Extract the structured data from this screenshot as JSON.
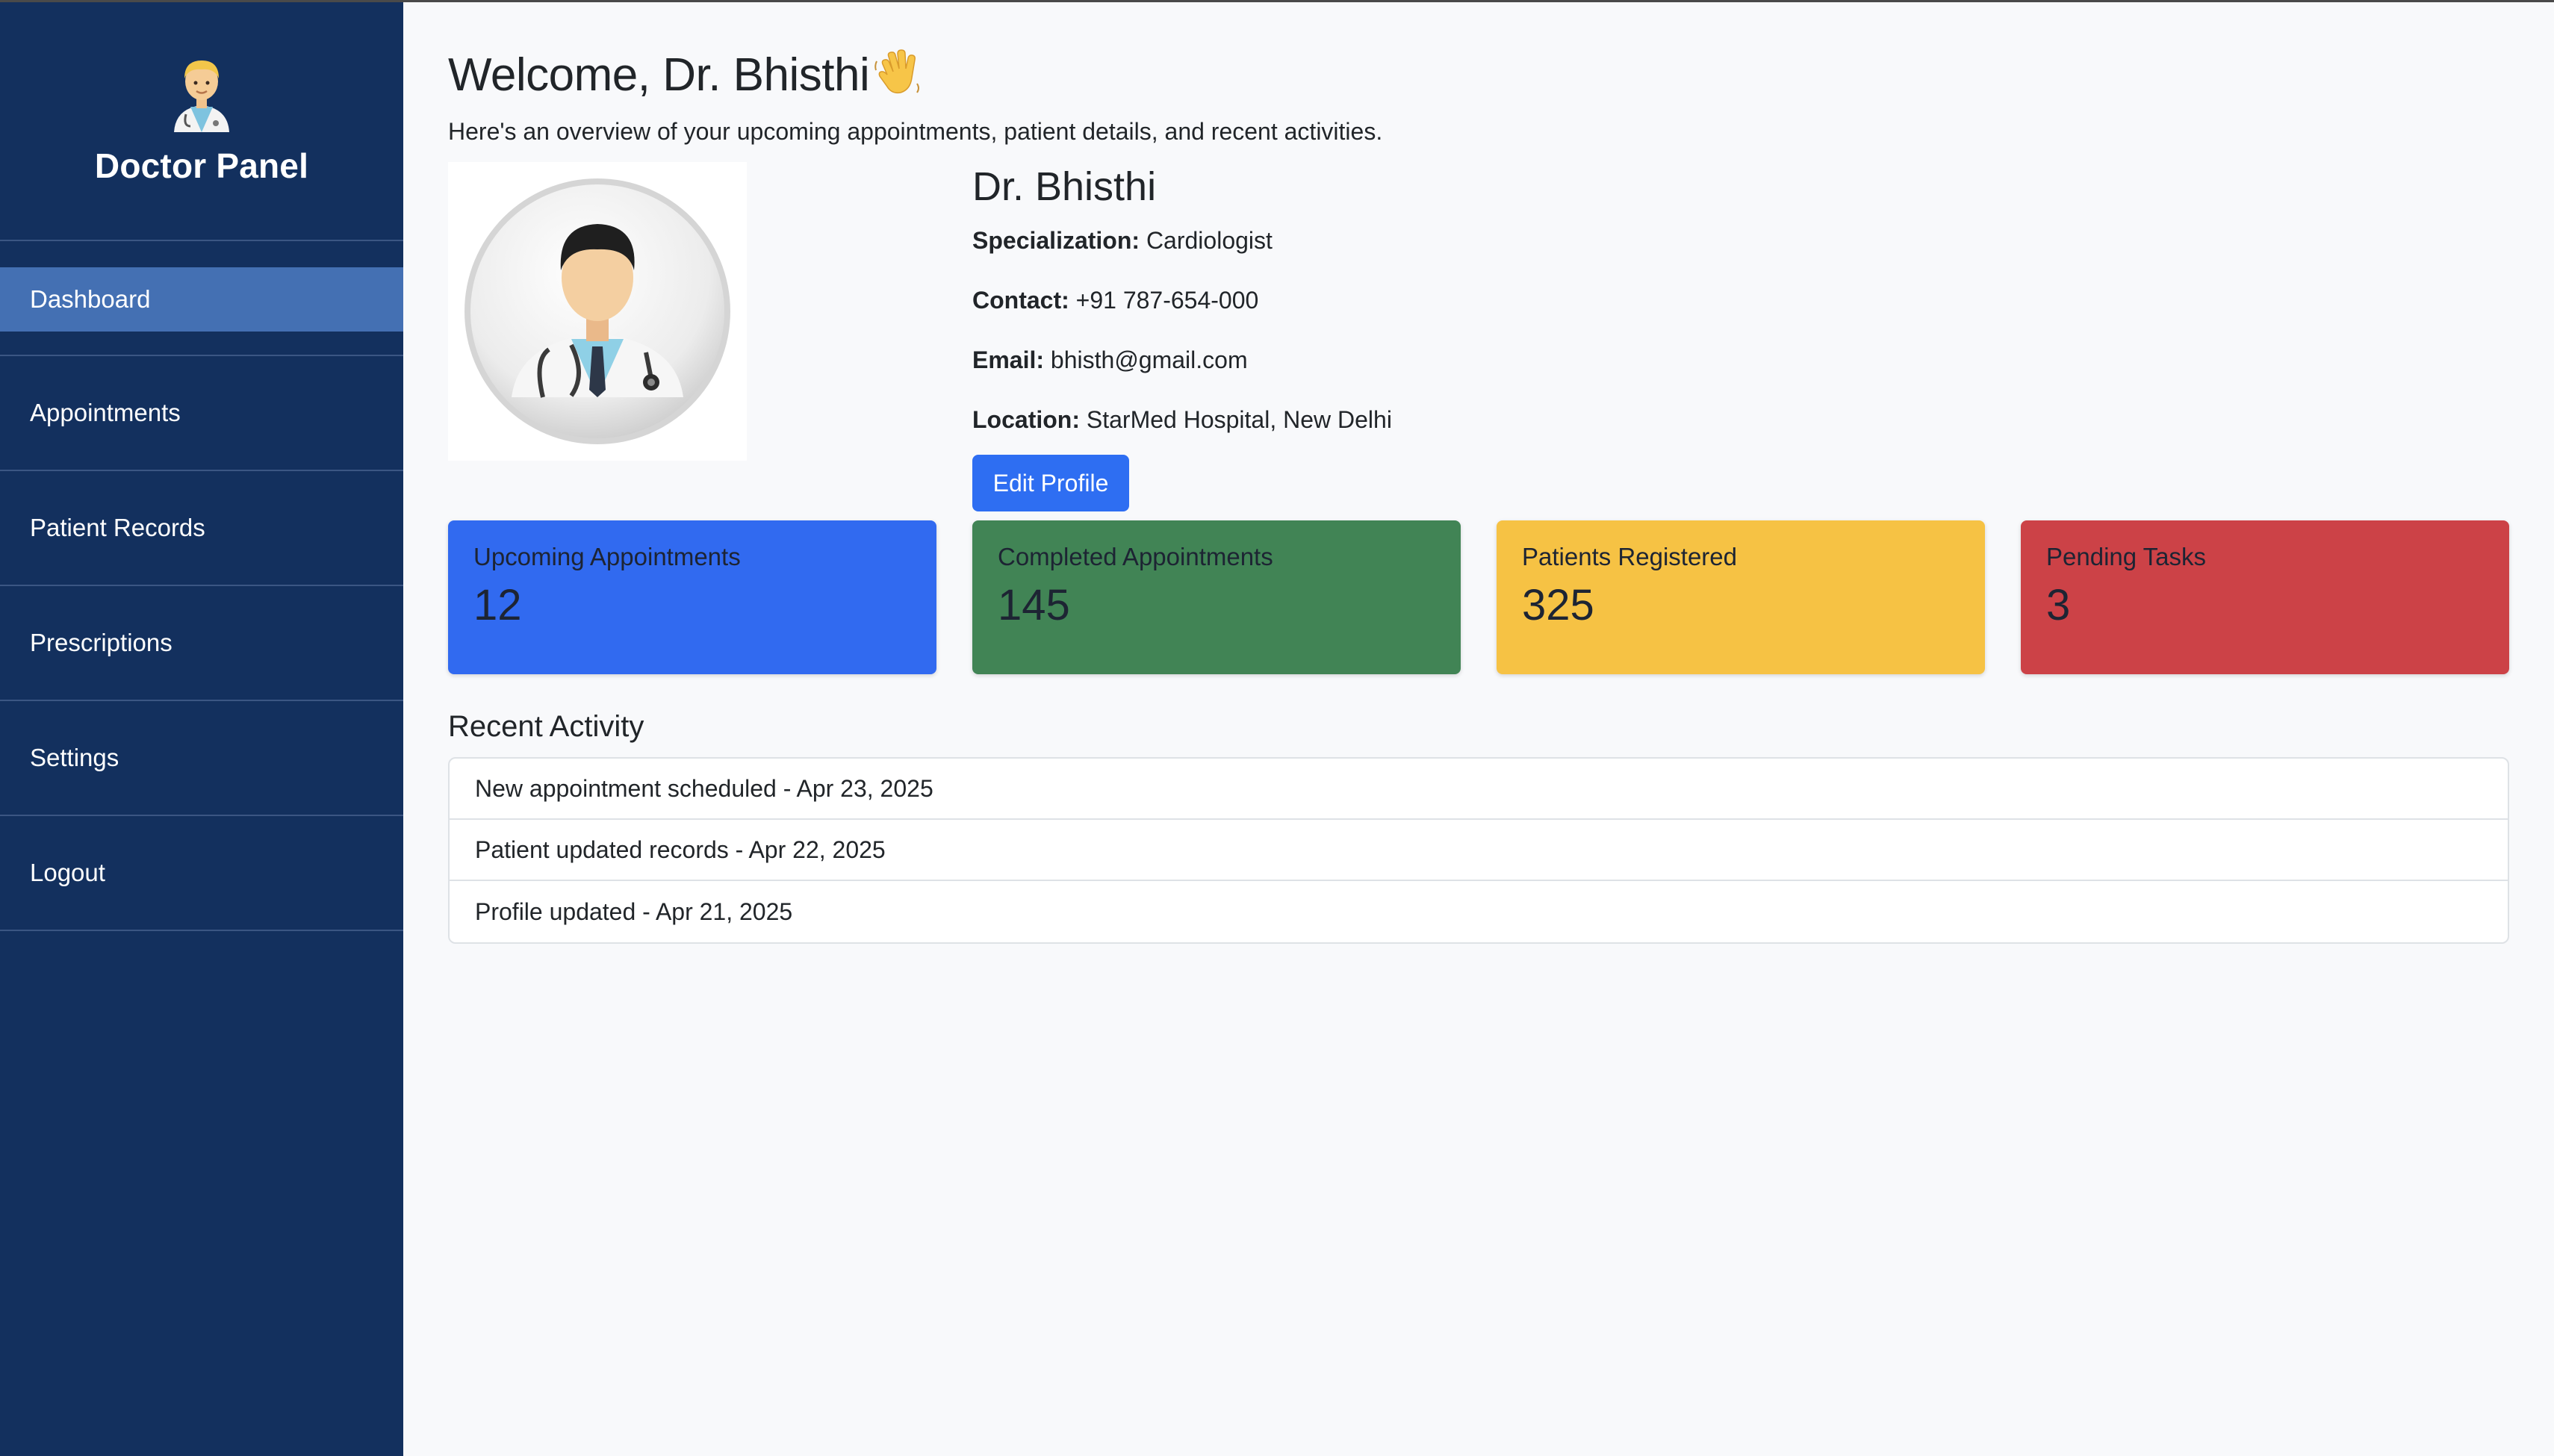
{
  "sidebar": {
    "brand_title": "Doctor Panel",
    "brand_icon": "doctor-icon",
    "items": [
      {
        "label": "Dashboard",
        "active": true
      },
      {
        "label": "Appointments"
      },
      {
        "label": "Patient Records"
      },
      {
        "label": "Prescriptions"
      },
      {
        "label": "Settings"
      },
      {
        "label": "Logout"
      }
    ]
  },
  "main": {
    "welcome_title": "Welcome, Dr. Bhisthi",
    "welcome_icon": "waving-hand-icon",
    "subtitle": "Here's an overview of your upcoming appointments, patient details, and recent activities."
  },
  "profile": {
    "name": "Dr. Bhisthi",
    "specialization_label": "Specialization:",
    "specialization": "Cardiologist",
    "contact_label": "Contact:",
    "contact": "+91 787-654-000",
    "email_label": "Email:",
    "email": "bhisth@gmail.com",
    "location_label": "Location:",
    "location": "StarMed Hospital, New Delhi",
    "edit_button": "Edit Profile"
  },
  "stats": [
    {
      "label": "Upcoming Appointments",
      "value": "12",
      "bg": "#316af0",
      "fg": "#1d2433"
    },
    {
      "label": "Completed Appointments",
      "value": "145",
      "bg": "#418455",
      "fg": "#1d2433"
    },
    {
      "label": "Patients Registered",
      "value": "325",
      "bg": "#f6c244",
      "fg": "#1d2433"
    },
    {
      "label": "Pending Tasks",
      "value": "3",
      "bg": "#cc4247",
      "fg": "#1d2433"
    }
  ],
  "recent": {
    "title": "Recent Activity",
    "items": [
      "New appointment scheduled - Apr 23, 2025",
      "Patient updated records - Apr 22, 2025",
      "Profile updated - Apr 21, 2025"
    ]
  },
  "colors": {
    "sidebar_bg": "#13305e",
    "active_item": "#4470b3",
    "primary_button": "#2e6ef2"
  }
}
